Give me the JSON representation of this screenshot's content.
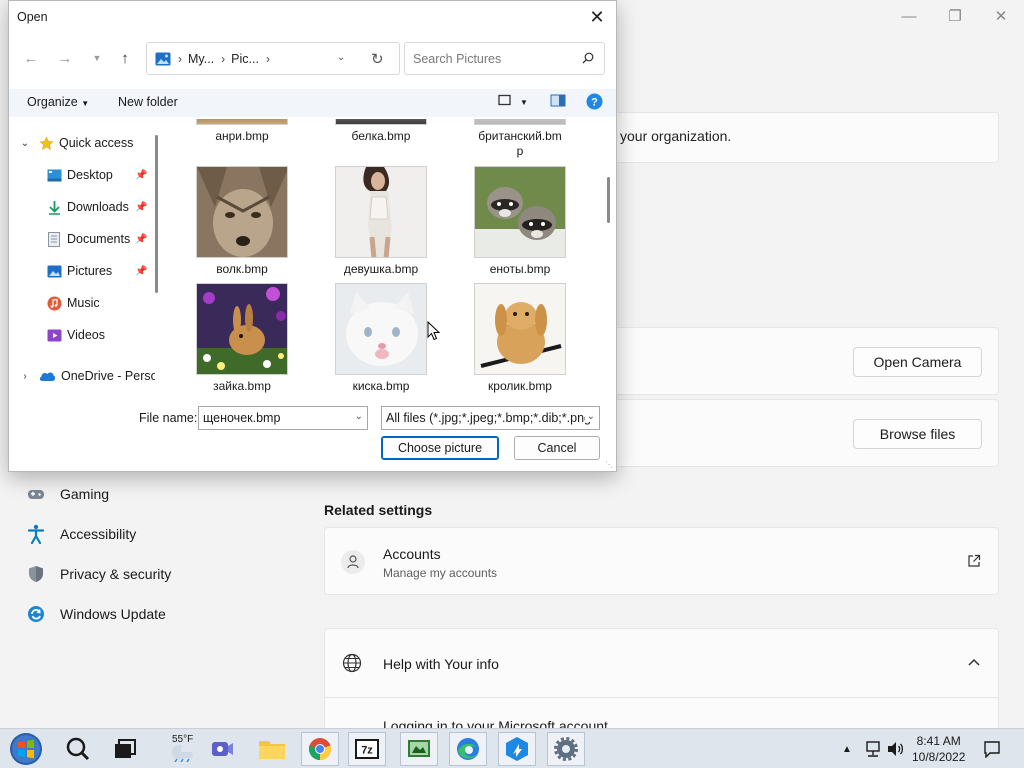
{
  "settings": {
    "org_text": "your organization.",
    "open_camera_label": "Open Camera",
    "browse_files_label": "Browse files",
    "nav": [
      {
        "label": "Gaming",
        "icon": "gamepad-icon"
      },
      {
        "label": "Accessibility",
        "icon": "accessibility-icon"
      },
      {
        "label": "Privacy & security",
        "icon": "shield-icon"
      },
      {
        "label": "Windows Update",
        "icon": "update-icon"
      }
    ],
    "related_settings_title": "Related settings",
    "accounts": {
      "title": "Accounts",
      "subtitle": "Manage my accounts",
      "icon": "person-icon"
    },
    "help": {
      "title": "Help with Your info",
      "link_text": "Logging in to your Microsoft account"
    }
  },
  "dialog": {
    "title": "Open",
    "breadcrumb": [
      "My...",
      "Pic..."
    ],
    "search_placeholder": "Search Pictures",
    "toolbar": {
      "organize_label": "Organize",
      "new_folder_label": "New folder"
    },
    "tree": [
      {
        "label": "Quick access",
        "icon": "star-icon",
        "pinned": false
      },
      {
        "label": "Desktop",
        "icon": "desktop-icon",
        "pinned": true
      },
      {
        "label": "Downloads",
        "icon": "download-icon",
        "pinned": true
      },
      {
        "label": "Documents",
        "icon": "document-icon",
        "pinned": true
      },
      {
        "label": "Pictures",
        "icon": "pictures-icon",
        "pinned": true
      },
      {
        "label": "Music",
        "icon": "music-icon",
        "pinned": false
      },
      {
        "label": "Videos",
        "icon": "video-icon",
        "pinned": false
      },
      {
        "label": "OneDrive - Perso",
        "icon": "cloud-icon",
        "pinned": false
      }
    ],
    "files_top_row": [
      "анри.bmp",
      "белка.bmp",
      "британский.bm\np"
    ],
    "files": [
      {
        "name": "волк.bmp",
        "subject": "wolf"
      },
      {
        "name": "девушка.bmp",
        "subject": "woman"
      },
      {
        "name": "еноты.bmp",
        "subject": "raccoons"
      },
      {
        "name": "зайка.bmp",
        "subject": "bunny"
      },
      {
        "name": "киска.bmp",
        "subject": "kitten"
      },
      {
        "name": "кролик.bmp",
        "subject": "rabbit"
      }
    ],
    "file_name_label": "File name:",
    "file_name_value": "щеночек.bmp",
    "file_type_value": "All files (*.jpg;*.jpeg;*.bmp;*.dib;*.png",
    "choose_label": "Choose picture",
    "cancel_label": "Cancel"
  },
  "taskbar": {
    "weather_temp": "55°F",
    "time": "8:41 AM",
    "date": "10/8/2022",
    "apps": [
      "start-icon",
      "search-icon",
      "task-view-icon",
      "weather-icon",
      "teams-icon",
      "file-explorer-icon",
      "chrome-icon",
      "7zip-icon",
      "app-icon",
      "edge-icon",
      "app-icon-2",
      "settings-icon"
    ]
  },
  "colors": {
    "accent": "#0067c0",
    "help_blue": "#1e88e5",
    "taskbar": "#dfe5ed"
  }
}
